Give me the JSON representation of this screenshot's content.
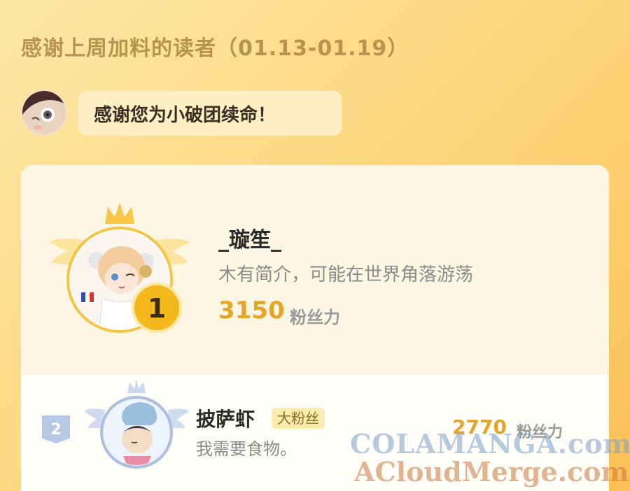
{
  "header": {
    "title": "感谢上周加料的读者（01.13-01.19）"
  },
  "greeting": {
    "text": "感谢您为小破团续命！"
  },
  "leaderboard": [
    {
      "rank": "1",
      "name": "_璇笙_",
      "bio": "木有简介，可能在世界角落游荡",
      "fans": "3150",
      "fans_label": "粉丝力"
    },
    {
      "rank": "2",
      "name": "披萨虾",
      "badge": "大粉丝",
      "bio": "我需要食物。",
      "fans": "2770",
      "fans_label": "粉丝力"
    }
  ],
  "watermark": {
    "line1": "COLAMANGA.com",
    "line2": "ACloudMerge.com"
  },
  "colors": {
    "accent": "#e7a32a",
    "gold": "#f5c027",
    "rank2": "#b7c9e4"
  }
}
